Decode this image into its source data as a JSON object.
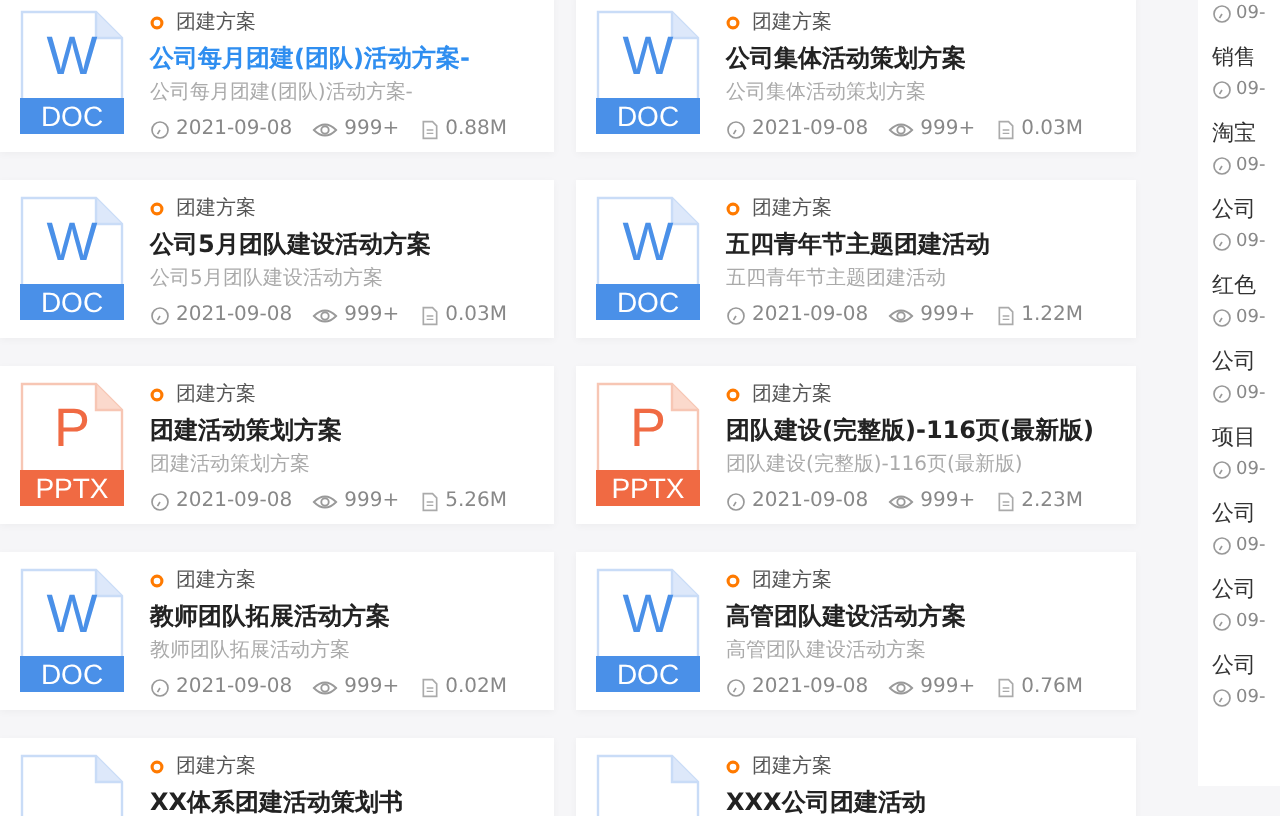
{
  "cards": [
    {
      "kind": "doc",
      "icon_letter": "W",
      "badge": "DOC",
      "category": "团建方案",
      "title": "公司每月团建(团队)活动方案-",
      "selected": true,
      "description": "公司每月团建(团队)活动方案-",
      "date": "2021-09-08",
      "views": "999+",
      "size": "0.88M"
    },
    {
      "kind": "doc",
      "icon_letter": "W",
      "badge": "DOC",
      "category": "团建方案",
      "title": "公司集体活动策划方案",
      "selected": false,
      "description": "公司集体活动策划方案",
      "date": "2021-09-08",
      "views": "999+",
      "size": "0.03M"
    },
    {
      "kind": "doc",
      "icon_letter": "W",
      "badge": "DOC",
      "category": "团建方案",
      "title": "公司5月团队建设活动方案",
      "selected": false,
      "description": "公司5月团队建设活动方案",
      "date": "2021-09-08",
      "views": "999+",
      "size": "0.03M"
    },
    {
      "kind": "doc",
      "icon_letter": "W",
      "badge": "DOC",
      "category": "团建方案",
      "title": "五四青年节主题团建活动",
      "selected": false,
      "description": "五四青年节主题团建活动",
      "date": "2021-09-08",
      "views": "999+",
      "size": "1.22M"
    },
    {
      "kind": "pptx",
      "icon_letter": "P",
      "badge": "PPTX",
      "category": "团建方案",
      "title": "团建活动策划方案",
      "selected": false,
      "description": "团建活动策划方案",
      "date": "2021-09-08",
      "views": "999+",
      "size": "5.26M"
    },
    {
      "kind": "pptx",
      "icon_letter": "P",
      "badge": "PPTX",
      "category": "团建方案",
      "title": "团队建设(完整版)-116页(最新版)",
      "selected": false,
      "description": "团队建设(完整版)-116页(最新版)",
      "date": "2021-09-08",
      "views": "999+",
      "size": "2.23M"
    },
    {
      "kind": "doc",
      "icon_letter": "W",
      "badge": "DOC",
      "category": "团建方案",
      "title": "教师团队拓展活动方案",
      "selected": false,
      "description": "教师团队拓展活动方案",
      "date": "2021-09-08",
      "views": "999+",
      "size": "0.02M"
    },
    {
      "kind": "doc",
      "icon_letter": "W",
      "badge": "DOC",
      "category": "团建方案",
      "title": "高管团队建设活动方案",
      "selected": false,
      "description": "高管团队建设活动方案",
      "date": "2021-09-08",
      "views": "999+",
      "size": "0.76M"
    },
    {
      "kind": "doc",
      "category": "团建方案",
      "title": "XX体系团建活动策划书",
      "selected": false
    },
    {
      "kind": "doc",
      "category": "团建方案",
      "title": "XXX公司团建活动",
      "selected": false
    }
  ],
  "sidebar": {
    "items": [
      {
        "date": "09-"
      },
      {
        "title": "销售",
        "date": "09-"
      },
      {
        "title": "淘宝",
        "date": "09-"
      },
      {
        "title": "公司",
        "date": "09-"
      },
      {
        "title": "红色",
        "date": "09-"
      },
      {
        "title": "公司",
        "date": "09-"
      },
      {
        "title": "项目",
        "date": "09-"
      },
      {
        "title": "公司",
        "date": "09-"
      },
      {
        "title": "公司",
        "date": "09-"
      },
      {
        "title": "公司",
        "date": "09-"
      }
    ]
  }
}
